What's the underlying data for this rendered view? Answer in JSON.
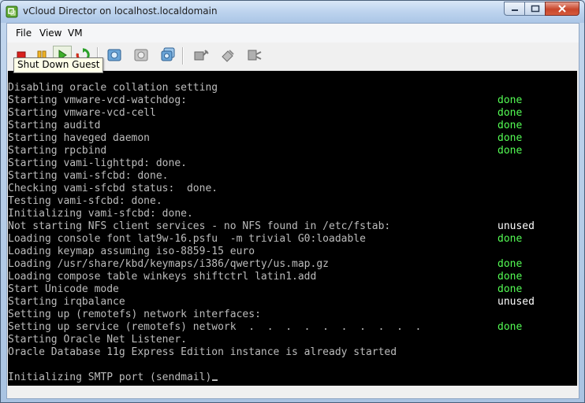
{
  "window": {
    "title": "vCloud Director on localhost.localdomain"
  },
  "menu": {
    "file": "File",
    "view": "View",
    "vm": "VM"
  },
  "toolbar": {
    "tooltip": "Shut Down Guest",
    "icons": [
      "power-off-icon",
      "pause-icon",
      "power-on-icon",
      "reset-icon",
      "snapshot-icon",
      "revert-snapshot-icon",
      "manage-snapshots-icon",
      "connect-device-icon",
      "disconnect-device-icon",
      "configure-device-icon"
    ]
  },
  "console": {
    "lines": [
      {
        "text": "Disabling oracle collation setting",
        "status": ""
      },
      {
        "text": "Starting vmware-vcd-watchdog:",
        "status": "done"
      },
      {
        "text": "Starting vmware-vcd-cell",
        "status": "done"
      },
      {
        "text": "Starting auditd",
        "status": "done"
      },
      {
        "text": "Starting haveged daemon",
        "status": "done"
      },
      {
        "text": "Starting rpcbind",
        "status": "done"
      },
      {
        "text": "Starting vami-lighttpd: done.",
        "status": ""
      },
      {
        "text": "Starting vami-sfcbd: done.",
        "status": ""
      },
      {
        "text": "Checking vami-sfcbd status:  done.",
        "status": ""
      },
      {
        "text": "Testing vami-sfcbd: done.",
        "status": ""
      },
      {
        "text": "Initializing vami-sfcbd: done.",
        "status": ""
      },
      {
        "text": "Not starting NFS client services - no NFS found in /etc/fstab:",
        "status": "unused"
      },
      {
        "text": "Loading console font lat9w-16.psfu  -m trivial G0:loadable",
        "status": "done"
      },
      {
        "text": "Loading keymap assuming iso-8859-15 euro",
        "status": ""
      },
      {
        "text": "Loading /usr/share/kbd/keymaps/i386/qwerty/us.map.gz",
        "status": "done"
      },
      {
        "text": "Loading compose table winkeys shiftctrl latin1.add",
        "status": "done"
      },
      {
        "text": "Start Unicode mode",
        "status": "done"
      },
      {
        "text": "Starting irqbalance",
        "status": "unused"
      },
      {
        "text": "Setting up (remotefs) network interfaces:",
        "status": ""
      },
      {
        "text": "Setting up service (remotefs) network  .  .  .  .  .  .  .  .  .  .",
        "status": "done"
      },
      {
        "text": "Starting Oracle Net Listener.",
        "status": ""
      },
      {
        "text": "Oracle Database 11g Express Edition instance is already started",
        "status": ""
      },
      {
        "text": "",
        "status": ""
      },
      {
        "text": "Initializing SMTP port (sendmail)",
        "status": "",
        "cursor": true
      }
    ]
  },
  "colors": {
    "console_bg": "#000000",
    "console_text": "#bcbcbc",
    "status_done": "#54fc54",
    "status_unused": "#ffffff"
  }
}
